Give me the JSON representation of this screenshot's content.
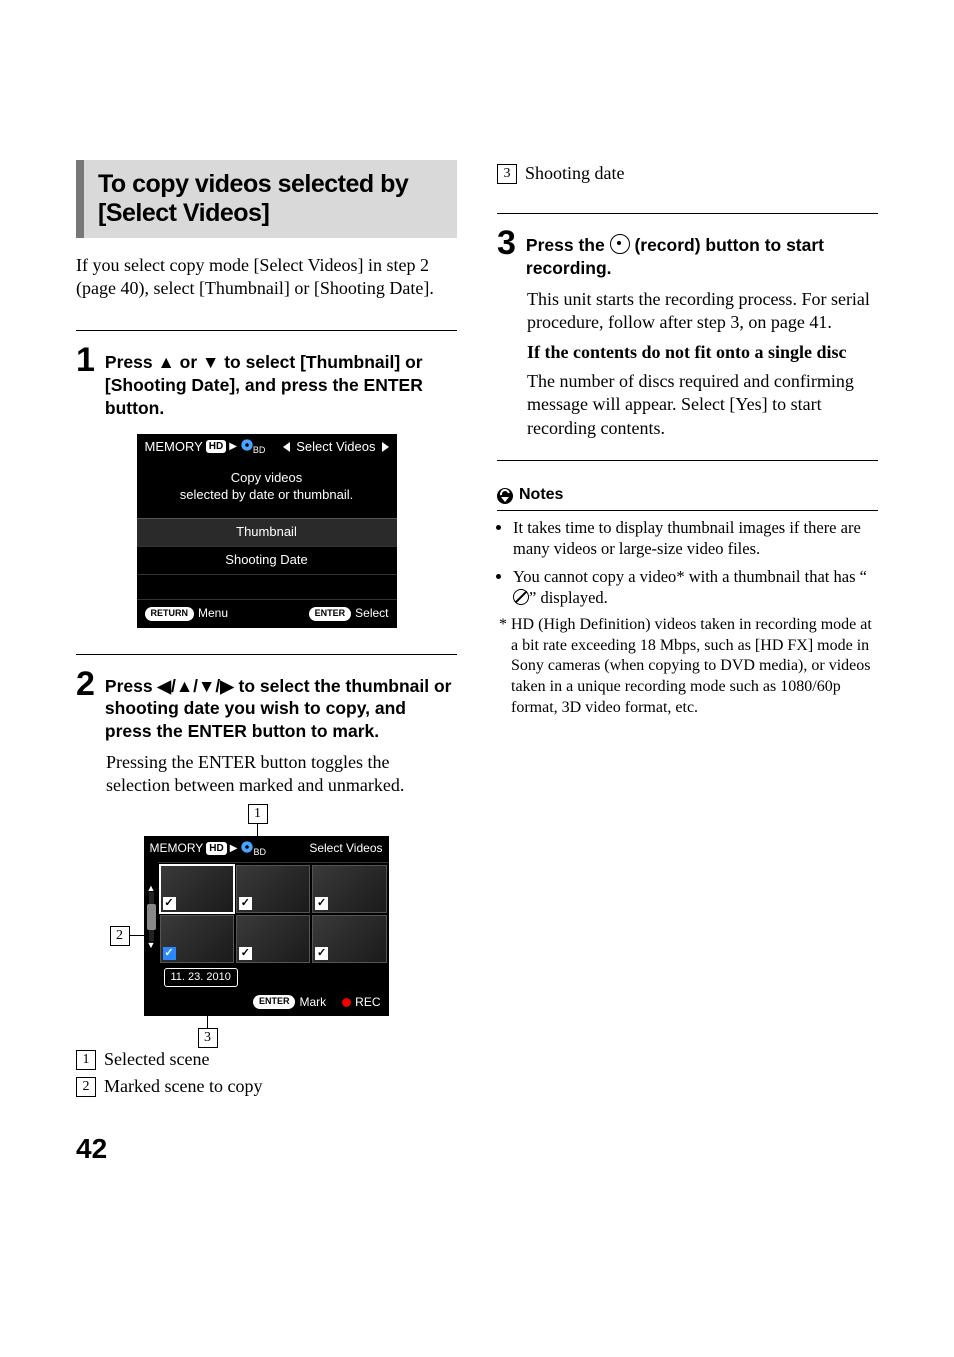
{
  "left": {
    "section_title": "To copy videos selected by [Select Videos]",
    "intro": "If you select copy mode [Select Videos] in step 2 (page 40), select [Thumbnail] or [Shooting Date].",
    "step1": {
      "num": "1",
      "text_a": "Press ",
      "text_b": " or ",
      "text_c": " to select [Thumbnail] or [Shooting Date], and press the ENTER button."
    },
    "lcd1": {
      "src": "MEMORY",
      "hd": "HD",
      "bd": "BD",
      "title": "Select Videos",
      "body_l1": "Copy videos",
      "body_l2": "selected by date or thumbnail.",
      "item1": "Thumbnail",
      "item2": "Shooting Date",
      "return": "RETURN",
      "menu": "Menu",
      "enter": "ENTER",
      "select": "Select"
    },
    "step2": {
      "num": "2",
      "text_a": "Press ",
      "text_b": " to select the thumbnail or shooting date you wish to copy, and press the ENTER button to mark.",
      "body": "Pressing the ENTER button toggles the selection between marked and unmarked."
    },
    "lcd2": {
      "src": "MEMORY",
      "hd": "HD",
      "bd": "BD",
      "title": "Select Videos",
      "date": "11. 23. 2010",
      "enter": "ENTER",
      "mark": "Mark",
      "rec": "REC"
    },
    "callout1": "1",
    "callout2": "2",
    "callout3": "3",
    "label1": "Selected scene",
    "label2": "Marked scene to copy"
  },
  "right": {
    "callout3": "3",
    "label3": "Shooting date",
    "step3": {
      "num": "3",
      "text_a": "Press the ",
      "text_b": " (record) button to start recording.",
      "body1": "This unit starts the recording process. For serial procedure, follow after step 3, on page 41.",
      "subhead": "If the contents do not fit onto a single disc",
      "body2": "The number of discs required and confirming message will appear. Select [Yes] to start recording contents."
    },
    "notes_title": "Notes",
    "note1": "It takes time to display thumbnail images if there are many videos or large-size video files.",
    "note2_a": "You cannot copy a video",
    "note2_b": " with a thumbnail that has “",
    "note2_c": "” displayed.",
    "footnote": "HD (High Definition) videos taken in recording mode at a bit rate exceeding 18 Mbps, such as [HD FX] mode in Sony cameras (when copying to DVD media), or videos taken in a unique recording mode such as 1080/60p format, 3D video format, etc.",
    "star": "*"
  },
  "page_number": "42"
}
